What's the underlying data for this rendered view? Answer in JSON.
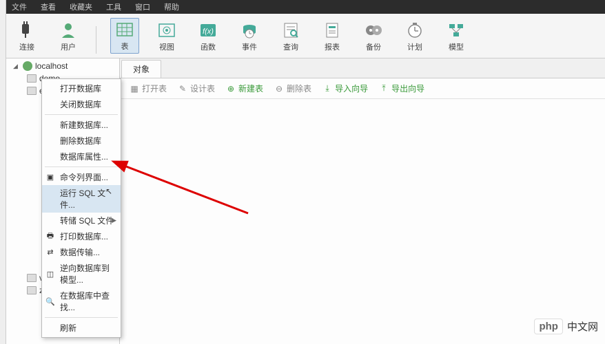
{
  "menubar": [
    "文件",
    "查看",
    "收藏夹",
    "工具",
    "窗口",
    "帮助"
  ],
  "toolbar": [
    {
      "label": "连接",
      "icon": "plug"
    },
    {
      "label": "用户",
      "icon": "user"
    },
    {
      "label": "表",
      "icon": "table",
      "selected": true
    },
    {
      "label": "视图",
      "icon": "view"
    },
    {
      "label": "函数",
      "icon": "fx"
    },
    {
      "label": "事件",
      "icon": "event"
    },
    {
      "label": "查询",
      "icon": "query"
    },
    {
      "label": "报表",
      "icon": "report"
    },
    {
      "label": "备份",
      "icon": "backup"
    },
    {
      "label": "计划",
      "icon": "schedule"
    },
    {
      "label": "模型",
      "icon": "model"
    }
  ],
  "tree": {
    "host": "localhost",
    "databases": [
      "demo",
      "edu",
      "video",
      "zh"
    ]
  },
  "tabs": {
    "active": "对象"
  },
  "obj_toolbar": [
    {
      "label": "打开表",
      "color": "#888"
    },
    {
      "label": "设计表",
      "color": "#888"
    },
    {
      "label": "新建表",
      "color": "#3a3",
      "icon": "plus"
    },
    {
      "label": "删除表",
      "color": "#888",
      "icon": "minus"
    },
    {
      "label": "导入向导",
      "color": "#3a3",
      "icon": "import"
    },
    {
      "label": "导出向导",
      "color": "#3a3",
      "icon": "export"
    }
  ],
  "context_menu": [
    {
      "label": "打开数据库"
    },
    {
      "label": "关闭数据库"
    },
    {
      "sep": true
    },
    {
      "label": "新建数据库..."
    },
    {
      "label": "删除数据库"
    },
    {
      "label": "数据库属性..."
    },
    {
      "sep": true
    },
    {
      "label": "命令列界面...",
      "icon": "cmd"
    },
    {
      "label": "运行 SQL 文件...",
      "hover": true,
      "cursor": true
    },
    {
      "label": "转储 SQL 文件",
      "submenu": true
    },
    {
      "label": "打印数据库...",
      "icon": "print"
    },
    {
      "label": "数据传输...",
      "icon": "transfer"
    },
    {
      "label": "逆向数据库到模型...",
      "icon": "model"
    },
    {
      "label": "在数据库中查找...",
      "icon": "search"
    },
    {
      "sep": true
    },
    {
      "label": "刷新"
    }
  ],
  "watermark": {
    "badge": "php",
    "text": "中文网"
  }
}
